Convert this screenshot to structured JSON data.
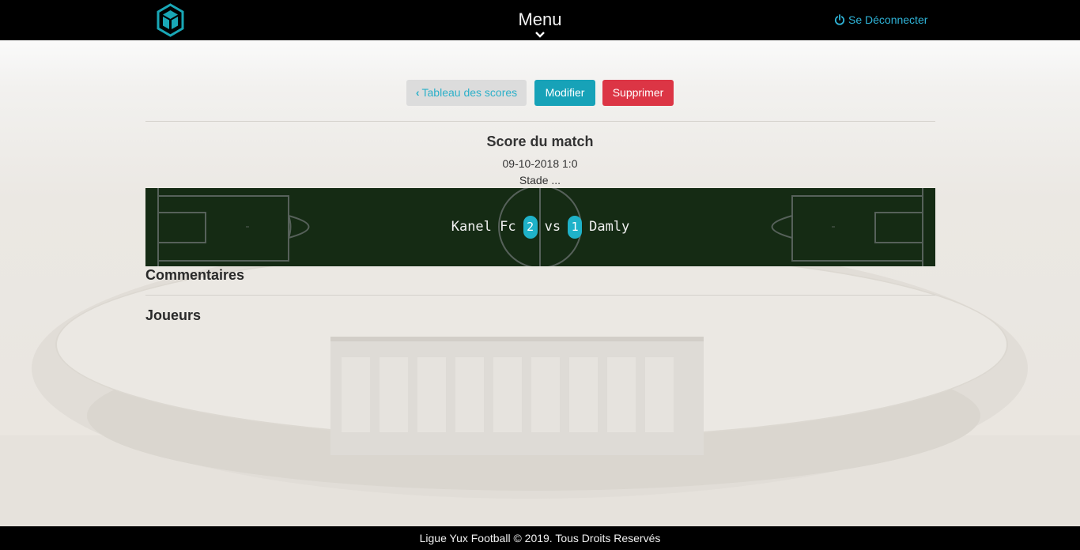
{
  "navbar": {
    "menu_label": "Menu",
    "logout_label": "Se Déconnecter",
    "logo_icon": "cube-logo-icon",
    "accent_color": "#2fb4d8"
  },
  "actions": {
    "back_label": "Tableau des scores",
    "edit_label": "Modifier",
    "delete_label": "Supprimer"
  },
  "match": {
    "heading": "Score du match",
    "date_score": "09-10-2018 1:0",
    "stadium": "Stade ...",
    "home_team": "Kanel Fc",
    "home_score": "2",
    "vs_label": "vs",
    "away_score": "1",
    "away_team": "Damly"
  },
  "sections": {
    "comments_title": "Commentaires",
    "players_title": "Joueurs"
  },
  "footer": {
    "text": "Ligue Yux Football © 2019. Tous Droits Reservés"
  },
  "colors": {
    "edit_button": "#17a2b8",
    "delete_button": "#dc3545",
    "score_badge": "#1fb2c9",
    "pitch": "#152b14"
  }
}
